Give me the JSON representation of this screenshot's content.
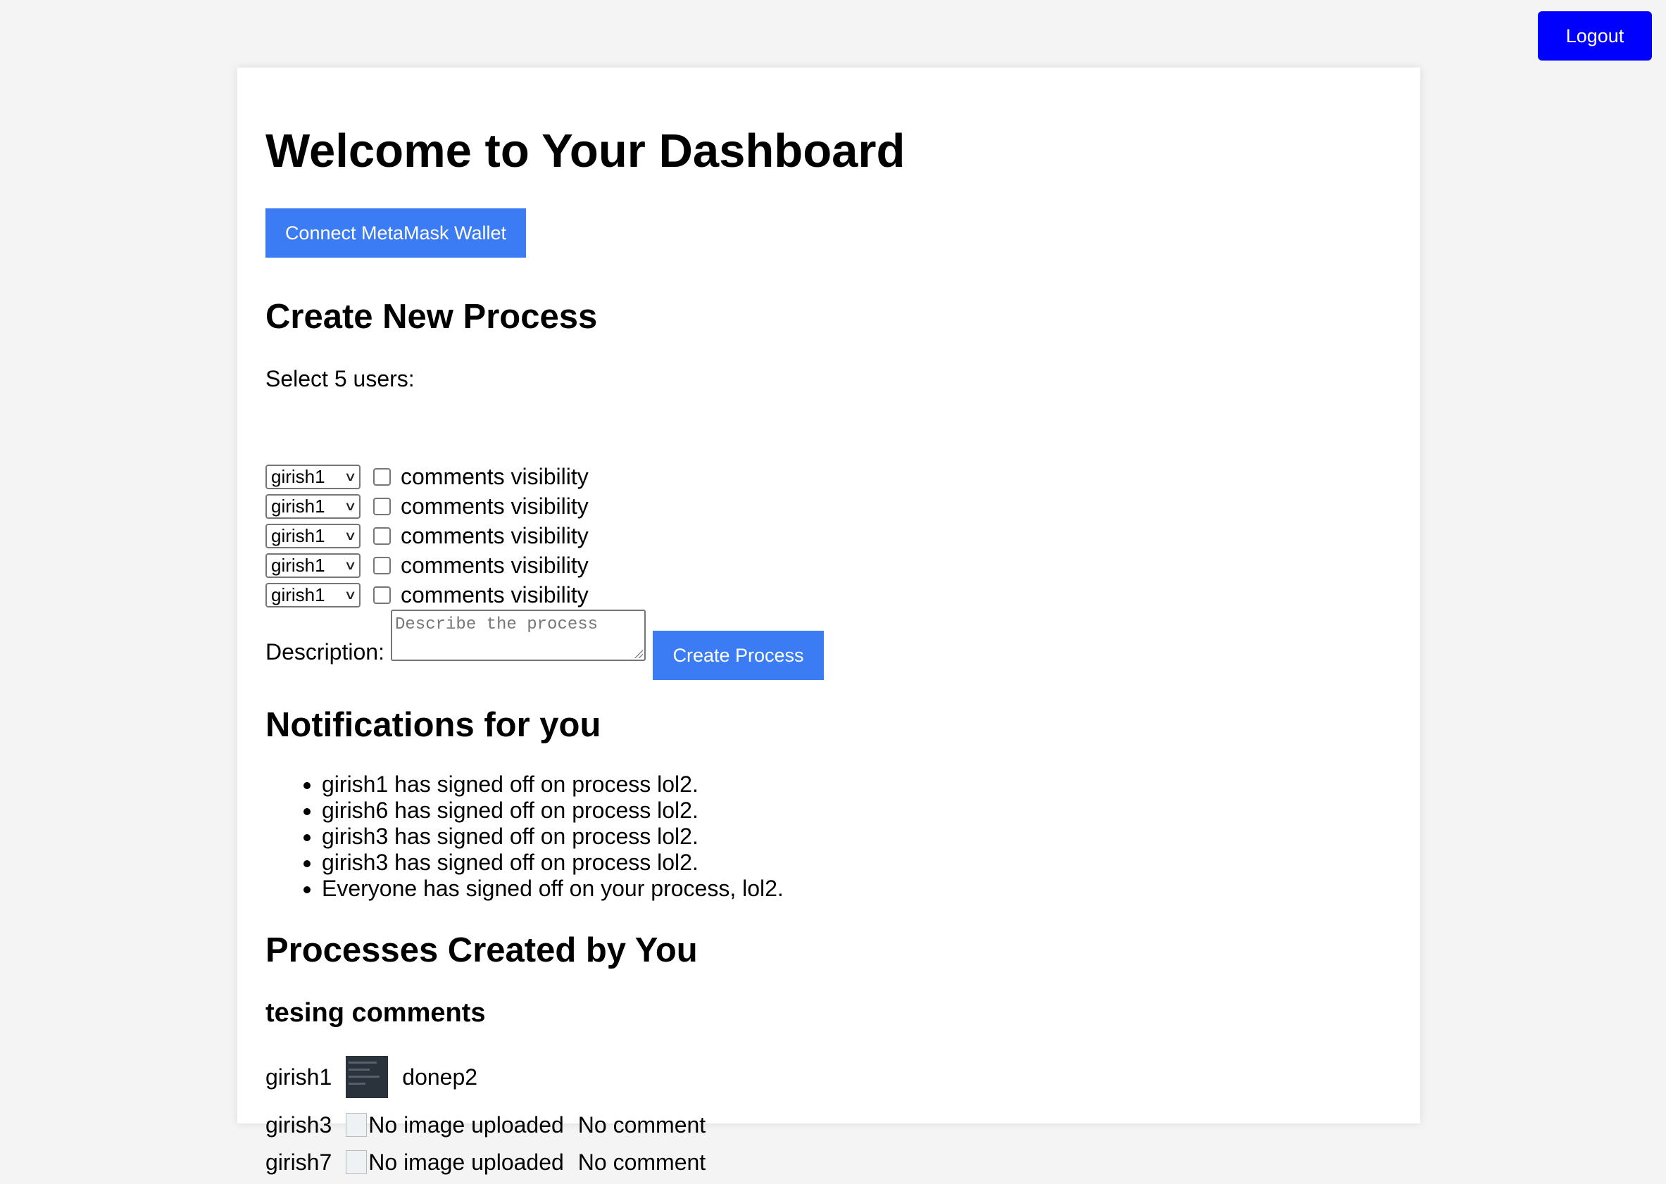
{
  "header": {
    "logout_label": "Logout"
  },
  "dashboard": {
    "title": "Welcome to Your Dashboard",
    "connect_wallet_label": "Connect MetaMask Wallet"
  },
  "create_process": {
    "heading": "Create New Process",
    "select_users_label": "Select 5 users:",
    "user_rows": [
      {
        "selected_user": "girish1",
        "visibility_label": "comments visibility",
        "checked": false
      },
      {
        "selected_user": "girish1",
        "visibility_label": "comments visibility",
        "checked": false
      },
      {
        "selected_user": "girish1",
        "visibility_label": "comments visibility",
        "checked": false
      },
      {
        "selected_user": "girish1",
        "visibility_label": "comments visibility",
        "checked": false
      },
      {
        "selected_user": "girish1",
        "visibility_label": "comments visibility",
        "checked": false
      }
    ],
    "description_label": "Description:",
    "description_placeholder": "Describe the process",
    "description_value": "",
    "submit_label": "Create Process"
  },
  "notifications": {
    "heading": "Notifications for you",
    "items": [
      "girish1 has signed off on process lol2.",
      "girish6 has signed off on process lol2.",
      "girish3 has signed off on process lol2.",
      "girish3 has signed off on process lol2.",
      "Everyone has signed off on your process, lol2."
    ]
  },
  "processes": {
    "heading": "Processes Created by You",
    "list": [
      {
        "name": "tesing comments",
        "entries": [
          {
            "user": "girish1",
            "image": "screenshot-thumbnail",
            "comment": "donep2"
          },
          {
            "user": "girish3",
            "image_alt": "No image uploaded",
            "comment": "No comment"
          },
          {
            "user": "girish7",
            "image_alt": "No image uploaded",
            "comment": "No comment"
          }
        ]
      }
    ]
  }
}
